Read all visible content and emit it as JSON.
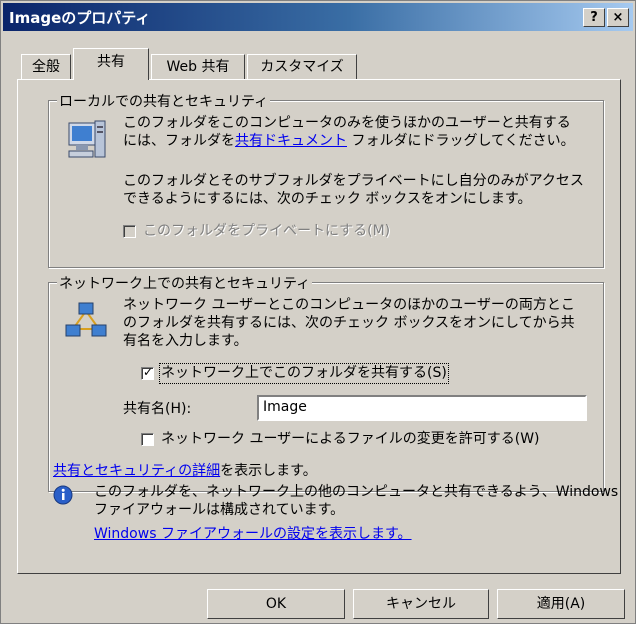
{
  "window": {
    "title": "Imageのプロパティ",
    "help_button": "?",
    "close_button": "×"
  },
  "tabs": [
    {
      "label": "全般",
      "active": false
    },
    {
      "label": "共有",
      "active": true
    },
    {
      "label": "Web 共有",
      "active": false
    },
    {
      "label": "カスタマイズ",
      "active": false
    }
  ],
  "local_sharing": {
    "legend": "ローカルでの共有とセキュリティ",
    "line1": "このフォルダをこのコンピュータのみを使うほかのユーザーと共有する",
    "line2_prefix": "には、フォルダを",
    "line2_link": "共有ドキュメント",
    "line2_suffix": " フォルダにドラッグしてください。",
    "line3": "このフォルダとそのサブフォルダをプライベートにし自分のみがアクセス",
    "line4": "できるようにするには、次のチェック ボックスをオンにします。",
    "private_checkbox": {
      "label": "このフォルダをプライベートにする(M)",
      "checked": false,
      "enabled": false
    }
  },
  "network_sharing": {
    "legend": "ネットワーク上での共有とセキュリティ",
    "line1": "ネットワーク ユーザーとこのコンピュータのほかのユーザーの両方とこ",
    "line2": "のフォルダを共有するには、次のチェック ボックスをオンにしてから共",
    "line3": "有名を入力します。",
    "share_checkbox": {
      "label": "ネットワーク上でこのフォルダを共有する(S)",
      "checked": true
    },
    "share_name_label": "共有名(H):",
    "share_name_value": "Image",
    "allow_change_checkbox": {
      "label": "ネットワーク ユーザーによるファイルの変更を許可する(W)",
      "checked": false
    },
    "details_link": "共有とセキュリティの詳細",
    "details_suffix": "を表示します。"
  },
  "firewall_info": {
    "line1": "このフォルダを、ネットワーク上の他のコンピュータと共有できるよう、Windows",
    "line2": "ファイアウォールは構成されています。",
    "link": "Windows ファイアウォールの設定を表示します。"
  },
  "buttons": {
    "ok": "OK",
    "cancel": "キャンセル",
    "apply": "適用(A)"
  }
}
